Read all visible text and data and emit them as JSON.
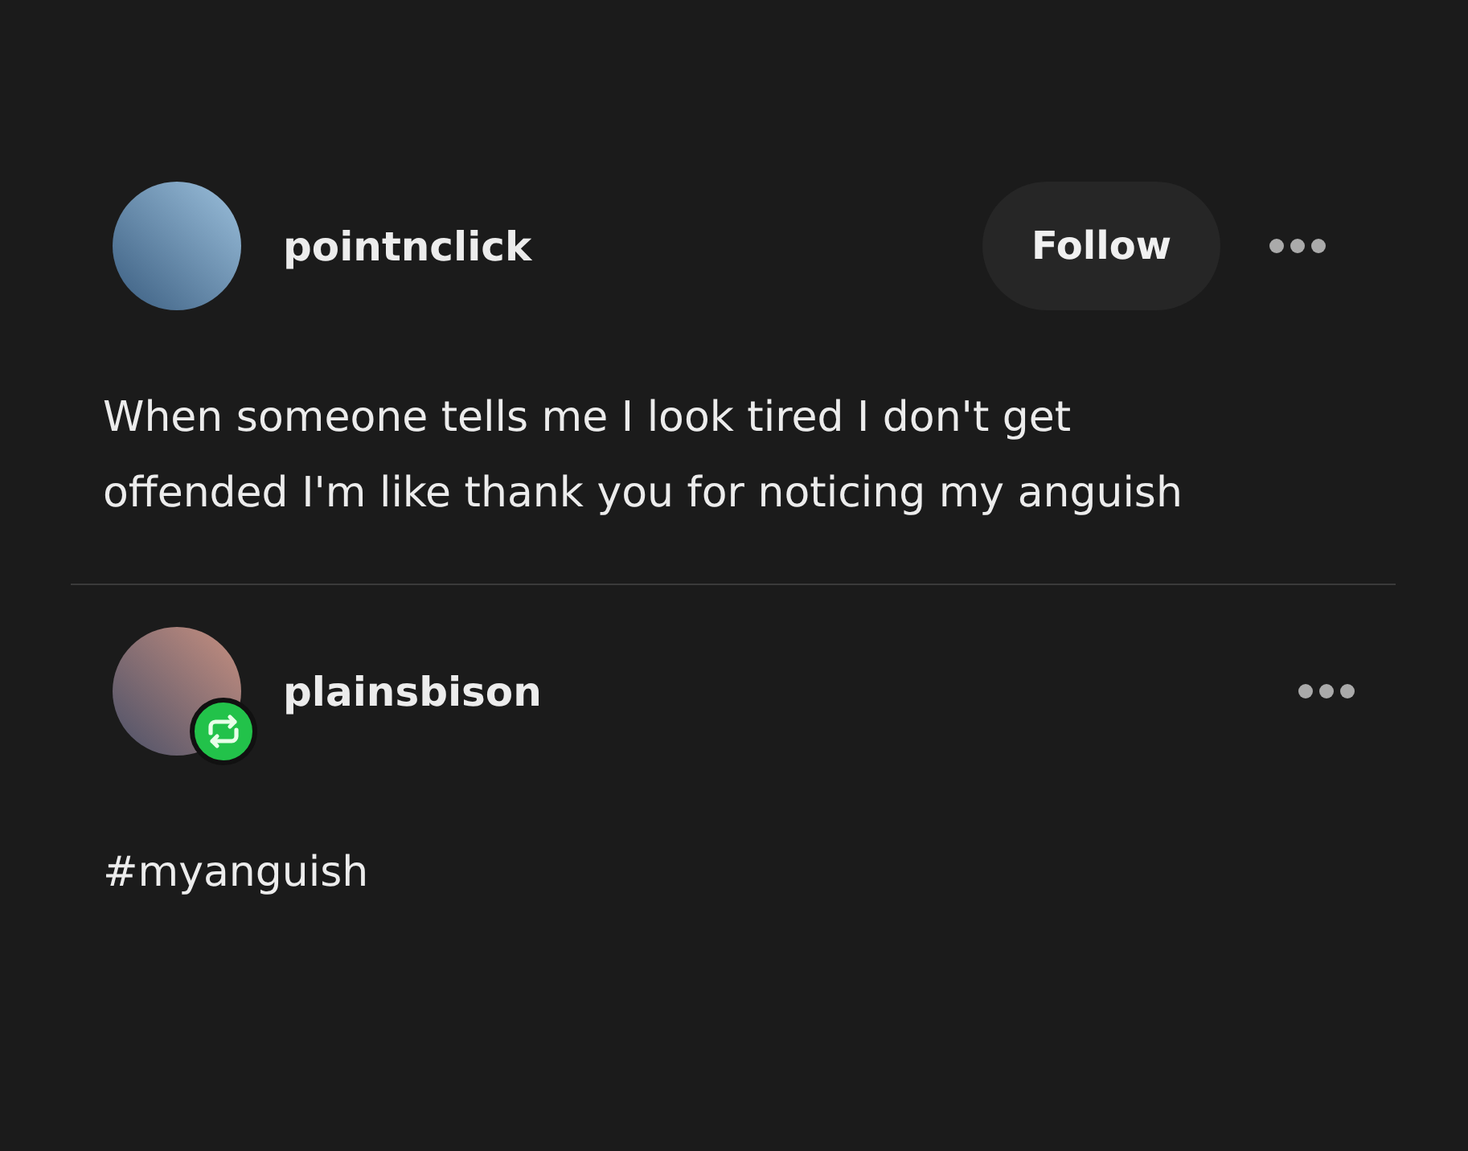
{
  "entries": [
    {
      "username": "pointnclick",
      "follow_button": "Follow",
      "reblogged": false,
      "text": "When someone tells me I look tired I don't get offended I'm like thank you for noticing my anguish"
    },
    {
      "username": "plainsbison",
      "reblogged": true,
      "text": "#myanguish"
    }
  ]
}
